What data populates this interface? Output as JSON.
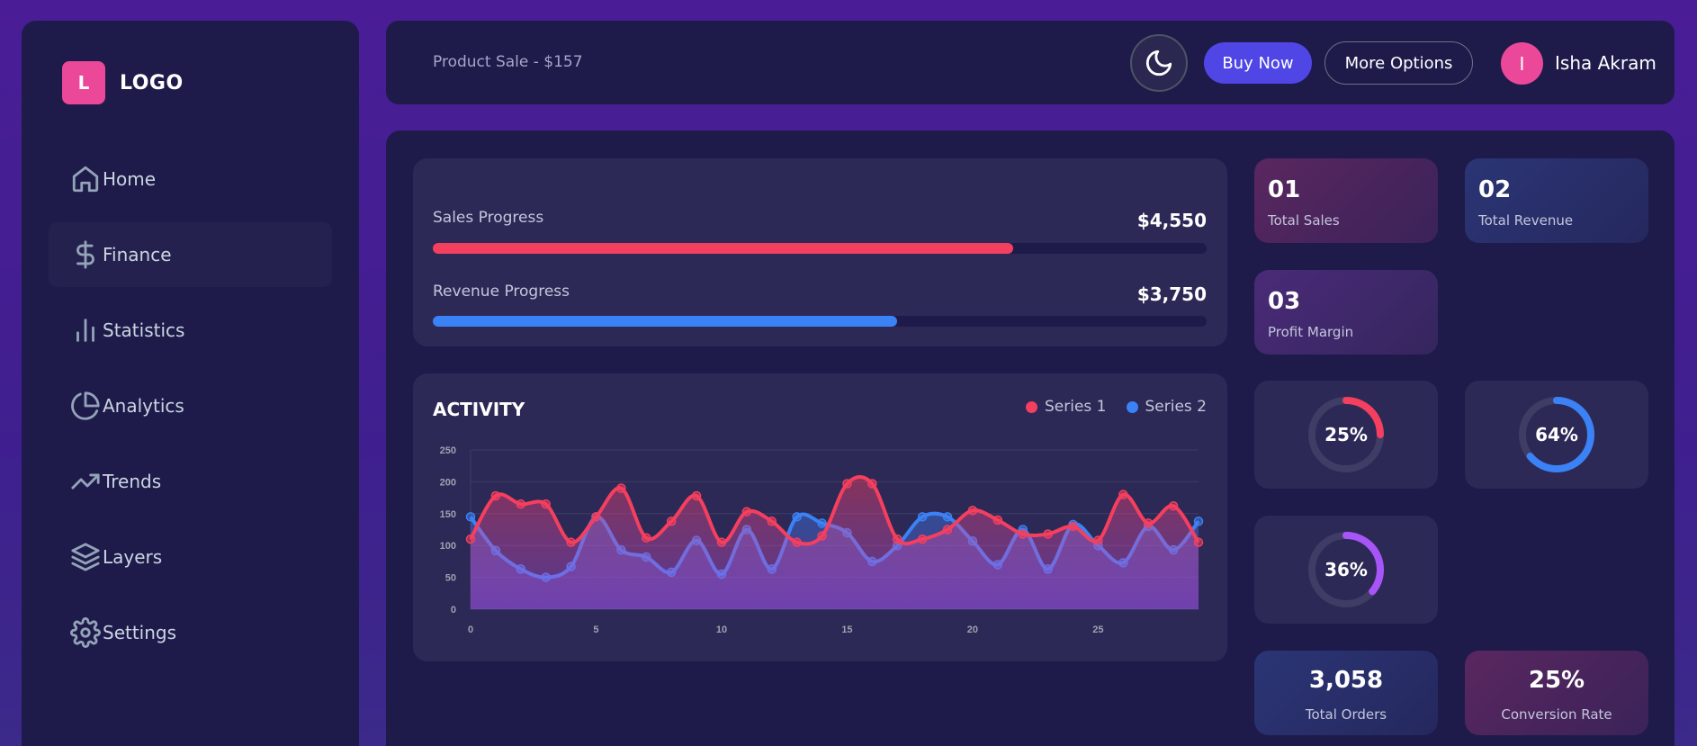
{
  "brand": {
    "badge": "L",
    "name": "LOGO",
    "color": "#ec4899"
  },
  "nav": [
    {
      "label": "Home",
      "icon": "home-icon"
    },
    {
      "label": "Finance",
      "icon": "dollar-icon",
      "active": true
    },
    {
      "label": "Statistics",
      "icon": "bar-chart-icon"
    },
    {
      "label": "Analytics",
      "icon": "pie-chart-icon"
    },
    {
      "label": "Trends",
      "icon": "trending-up-icon"
    },
    {
      "label": "Layers",
      "icon": "layers-icon"
    },
    {
      "label": "Settings",
      "icon": "gear-icon"
    }
  ],
  "header": {
    "product_sale": "Product Sale - $157",
    "theme_icon": "moon-icon",
    "buy_label": "Buy Now",
    "more_label": "More Options",
    "avatar_initial": "I",
    "user_name": "Isha Akram"
  },
  "progress": {
    "sales": {
      "label": "Sales Progress",
      "value": "$4,550",
      "fraction": 0.75,
      "color": "#f43f5e"
    },
    "revenue": {
      "label": "Revenue Progress",
      "value": "$3,750",
      "fraction": 0.6,
      "color": "#3b82f6"
    }
  },
  "activity": {
    "title": "ACTIVITY",
    "legend": [
      {
        "name": "Series 1",
        "color": "#f43f5e"
      },
      {
        "name": "Series 2",
        "color": "#3b82f6"
      }
    ]
  },
  "stats": [
    {
      "num": "01",
      "label": "Total Sales"
    },
    {
      "num": "02",
      "label": "Total Revenue"
    },
    {
      "num": "03",
      "label": "Profit Margin"
    }
  ],
  "rings": [
    {
      "text": "25%",
      "value": 0.25,
      "color": "#f43f5e"
    },
    {
      "text": "64%",
      "value": 0.64,
      "color": "#3b82f6"
    },
    {
      "text": "36%",
      "value": 0.36,
      "color": "#a855f7"
    }
  ],
  "kpis": [
    {
      "num": "3,058",
      "label": "Total Orders"
    },
    {
      "num": "25%",
      "label": "Conversion Rate"
    }
  ],
  "chart_data": {
    "type": "area",
    "x": [
      0,
      1,
      2,
      3,
      4,
      5,
      6,
      7,
      8,
      9,
      10,
      11,
      12,
      13,
      14,
      15,
      16,
      17,
      18,
      19,
      20,
      21,
      22,
      23,
      24,
      25,
      26,
      27,
      28,
      29
    ],
    "xticks": [
      0,
      5,
      10,
      15,
      20,
      25
    ],
    "yticks": [
      0,
      50,
      100,
      150,
      200,
      250
    ],
    "ylim": [
      0,
      250
    ],
    "xlim": [
      0,
      29
    ],
    "series": [
      {
        "name": "Series 1",
        "color": "#f43f5e",
        "values": [
          110,
          178,
          165,
          165,
          105,
          145,
          190,
          112,
          138,
          178,
          105,
          153,
          138,
          105,
          115,
          197,
          197,
          110,
          110,
          125,
          155,
          140,
          118,
          118,
          130,
          108,
          180,
          135,
          162,
          105
        ]
      },
      {
        "name": "Series 2",
        "color": "#3b82f6",
        "values": [
          145,
          92,
          63,
          50,
          67,
          145,
          93,
          82,
          58,
          108,
          55,
          125,
          63,
          145,
          135,
          120,
          75,
          100,
          145,
          145,
          107,
          70,
          125,
          63,
          133,
          100,
          73,
          130,
          93,
          138
        ]
      }
    ]
  }
}
